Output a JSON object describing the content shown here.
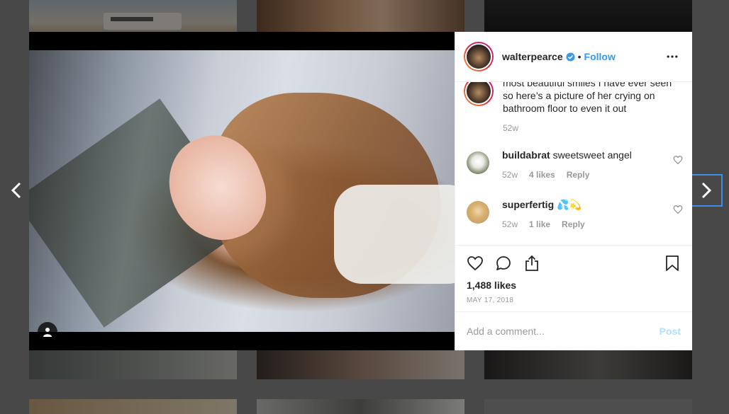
{
  "post": {
    "username": "walterpearce",
    "dot": "•",
    "follow_label": "Follow",
    "caption": {
      "text": "most beautiful smiles I have ever seen so here’s a picture of her crying on bathroom floor to even it out",
      "time": "52w"
    },
    "comments": [
      {
        "username": "buildabrat",
        "text": "sweetsweet angel",
        "time": "52w",
        "likes": "4 likes",
        "reply_label": "Reply"
      },
      {
        "username": "superfertig",
        "text": "💦💫",
        "time": "52w",
        "likes": "1 like",
        "reply_label": "Reply"
      }
    ],
    "likes_count": "1,488 likes",
    "date": "MAY 17, 2018"
  },
  "comment_box": {
    "placeholder": "Add a comment...",
    "post_label": "Post"
  },
  "icons": {
    "more": "more-options-icon",
    "like": "heart-icon",
    "comment": "comment-bubble-icon",
    "share": "share-icon",
    "save": "bookmark-icon",
    "user_tag": "user-tag-icon",
    "nav_prev": "chevron-left-icon",
    "nav_next": "chevron-right-icon",
    "verified": "verified-badge-icon"
  },
  "colors": {
    "link": "#3897f0",
    "post_disabled": "#b2dffc",
    "muted": "#999999",
    "nav_focus": "#3b8fe6"
  }
}
